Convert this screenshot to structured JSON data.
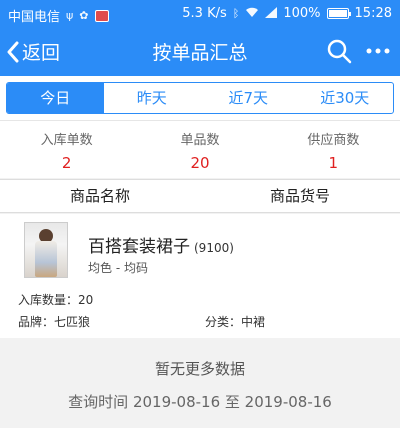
{
  "status_bar": {
    "carrier": "中国电信",
    "speed": "5.3 K/s",
    "battery": "100%",
    "battery_level": 1.0,
    "time": "15:28"
  },
  "header": {
    "back_label": "返回",
    "title": "按单品汇总"
  },
  "date_tabs": [
    {
      "label": "今日",
      "active": true
    },
    {
      "label": "昨天",
      "active": false
    },
    {
      "label": "近7天",
      "active": false
    },
    {
      "label": "近30天",
      "active": false
    }
  ],
  "summary": [
    {
      "label": "入库单数",
      "value": "2"
    },
    {
      "label": "单品数",
      "value": "20"
    },
    {
      "label": "供应商数",
      "value": "1"
    }
  ],
  "columns": [
    "商品名称",
    "商品货号"
  ],
  "product": {
    "name": "百搭套装裙子",
    "code": "(9100)",
    "spec": "均色 - 均码",
    "qty": "入库数量：20",
    "brand": "品牌：七匹狼",
    "category": "分类：中裙"
  },
  "footer": {
    "no_more": "暂无更多数据",
    "query_time": "查询时间 2019-08-16 至 2019-08-16"
  },
  "colors": {
    "primary": "#2b8cf7",
    "value_red": "#e02020"
  }
}
